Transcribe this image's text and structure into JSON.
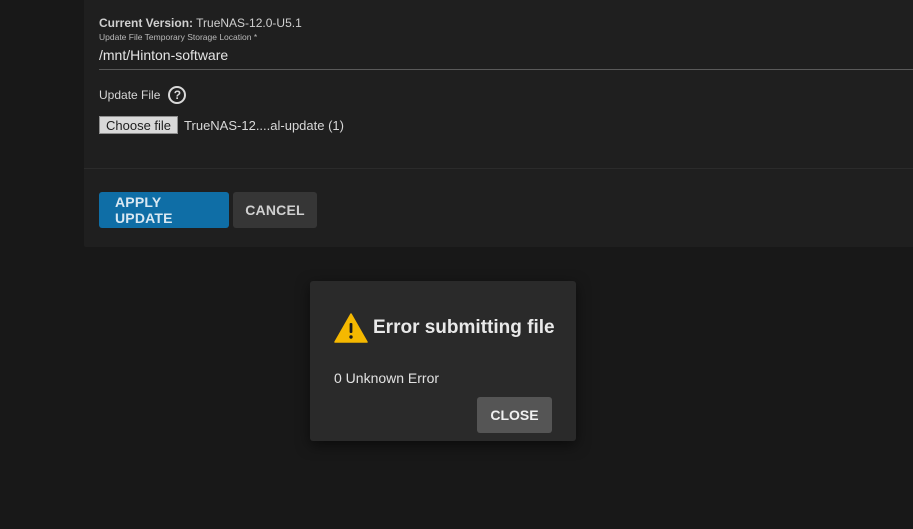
{
  "form": {
    "current_version_label": "Current Version:",
    "current_version_value": "TrueNAS-12.0-U5.1",
    "storage_location_label": "Update File Temporary Storage Location *",
    "storage_location_value": "/mnt/Hinton-software",
    "update_file_label": "Update File",
    "choose_file_label": "Choose file",
    "selected_file_name": "TrueNAS-12....al-update (1)"
  },
  "actions": {
    "apply_label": "APPLY UPDATE",
    "cancel_label": "CANCEL"
  },
  "dialog": {
    "title": "Error submitting file",
    "message": "0 Unknown Error",
    "close_label": "CLOSE"
  },
  "colors": {
    "background": "#181818",
    "card": "#1f1f1f",
    "primary": "#0f6ea6",
    "warning": "#f5b800",
    "dialog": "#2a2a2a"
  },
  "icons": {
    "help": "help-circle-icon",
    "warning": "warning-triangle-icon"
  }
}
